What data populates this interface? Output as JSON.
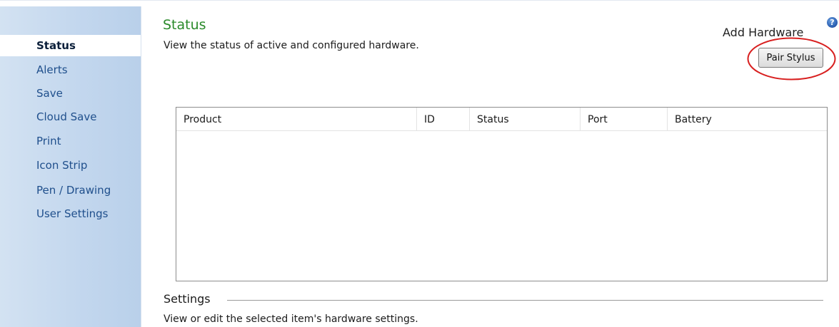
{
  "sidebar": {
    "items": [
      {
        "label": "Status",
        "active": true
      },
      {
        "label": "Alerts",
        "active": false
      },
      {
        "label": "Save",
        "active": false
      },
      {
        "label": "Cloud Save",
        "active": false
      },
      {
        "label": "Print",
        "active": false
      },
      {
        "label": "Icon Strip",
        "active": false
      },
      {
        "label": "Pen / Drawing",
        "active": false
      },
      {
        "label": "User Settings",
        "active": false
      }
    ]
  },
  "main": {
    "title": "Status",
    "subtitle": "View the status of active and configured hardware.",
    "add_hardware_label": "Add Hardware",
    "help_icon": "help-icon",
    "pair_button_label": "Pair Stylus",
    "annotation_color": "#d81f1f",
    "table": {
      "columns": [
        "Product",
        "ID",
        "Status",
        "Port",
        "Battery"
      ],
      "rows": []
    },
    "settings": {
      "label": "Settings",
      "subtitle": "View or edit the selected item's hardware settings."
    }
  },
  "colors": {
    "title_green": "#2a8a2a",
    "nav_blue": "#1f4f8c",
    "sidebar_bg": "#c3d7ee"
  }
}
